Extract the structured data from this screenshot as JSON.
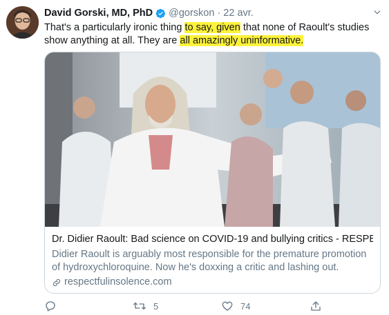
{
  "tweet": {
    "author_name": "David Gorski, MD, PhD",
    "handle": "@gorskon",
    "separator": "·",
    "date": "22 avr.",
    "text_before": "That's a particularly ironic thing ",
    "text_hl1": "to say, given",
    "text_mid": " that none of Raoult's studies show anything at all. They are ",
    "text_hl2": "all amazingly uninformative."
  },
  "card": {
    "title": "Dr. Didier Raoult: Bad science on COVID-19 and bullying critics - RESPE...",
    "description": "Didier Raoult is arguably most responsible for the premature promotion of hydroxychloroquine. Now he's doxxing a critic and lashing out.",
    "domain": "respectfulinsolence.com"
  },
  "actions": {
    "reply_count": "",
    "retweet_count": "5",
    "like_count": "74"
  },
  "colors": {
    "highlight": "#fdf23a",
    "verified": "#1da1f2",
    "secondary_text": "#657786"
  },
  "icons": [
    "verified-icon",
    "caret-down-icon",
    "link-icon",
    "reply-icon",
    "retweet-icon",
    "like-icon",
    "share-icon"
  ]
}
